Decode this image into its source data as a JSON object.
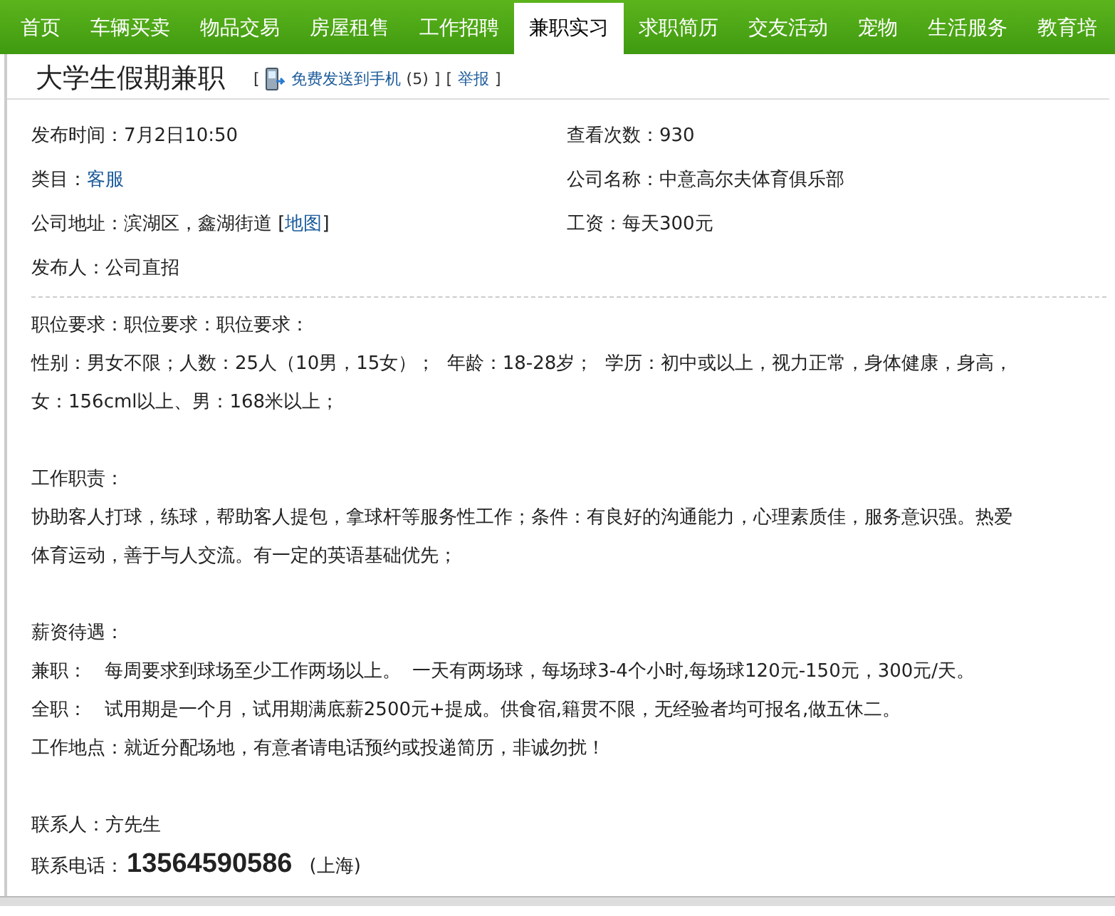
{
  "nav": [
    {
      "label": "首页",
      "selected": false
    },
    {
      "label": "车辆买卖",
      "selected": false
    },
    {
      "label": "物品交易",
      "selected": false
    },
    {
      "label": "房屋租售",
      "selected": false
    },
    {
      "label": "工作招聘",
      "selected": false
    },
    {
      "label": "兼职实习",
      "selected": true
    },
    {
      "label": "求职简历",
      "selected": false
    },
    {
      "label": "交友活动",
      "selected": false
    },
    {
      "label": "宠物",
      "selected": false
    },
    {
      "label": "生活服务",
      "selected": false
    },
    {
      "label": "教育培",
      "selected": false
    }
  ],
  "title": "大学生假期兼职",
  "header_items": [
    {
      "kind": "text",
      "text": "["
    },
    {
      "kind": "send_link",
      "text": "免费发送到手机"
    },
    {
      "kind": "text",
      "text": "(5)"
    },
    {
      "kind": "text",
      "text": "]"
    },
    {
      "kind": "text",
      "text": "["
    },
    {
      "kind": "report_link",
      "text": "举报"
    },
    {
      "kind": "text",
      "text": "]"
    }
  ],
  "info": [
    {
      "label": "发布时间：",
      "value": "7月2日10:50"
    },
    {
      "label": "查看次数：",
      "value": "930"
    },
    {
      "label": "类目：",
      "value": "客服",
      "kind": "link"
    },
    {
      "label": "公司名称：",
      "value": "中意高尔夫体育俱乐部"
    },
    {
      "label": "公司地址：",
      "value": "滨湖区，鑫湖街道",
      "map_link": {
        "open": "[",
        "text": "地图",
        "close": "]"
      }
    },
    {
      "label": "工资：",
      "value": "每天300元"
    },
    {
      "label": "发布人：",
      "value": "公司直招"
    }
  ],
  "sections": [
    [
      "职位要求：职位要求：职位要求：",
      "性别：男女不限；人数：25人（10男，15女）；  年龄：18-28岁；  学历：初中或以上，视力正常，身体健康，身高，",
      "女：156cml以上、男：168米以上；"
    ],
    [
      "工作职责：",
      "协助客人打球，练球，帮助客人提包，拿球杆等服务性工作；条件：有良好的沟通能力，心理素质佳，服务意识强。热爱",
      "体育运动，善于与人交流。有一定的英语基础优先；"
    ],
    [
      "薪资待遇：",
      "兼职：   每周要求到球场至少工作两场以上。  一天有两场球，每场球3-4个小时,每场球120元-150元，300元/天。",
      "全职：   试用期是一个月，试用期满底薪2500元+提成。供食宿,籍贯不限，无经验者均可报名,做五休二。",
      "工作地点：就近分配场地，有意者请电话预约或投递简历，非诚勿扰！"
    ]
  ],
  "contact": {
    "person": "联系人：方先生",
    "phone_label": "联系电话：",
    "phone": "13564590586",
    "region": "(上海)"
  }
}
